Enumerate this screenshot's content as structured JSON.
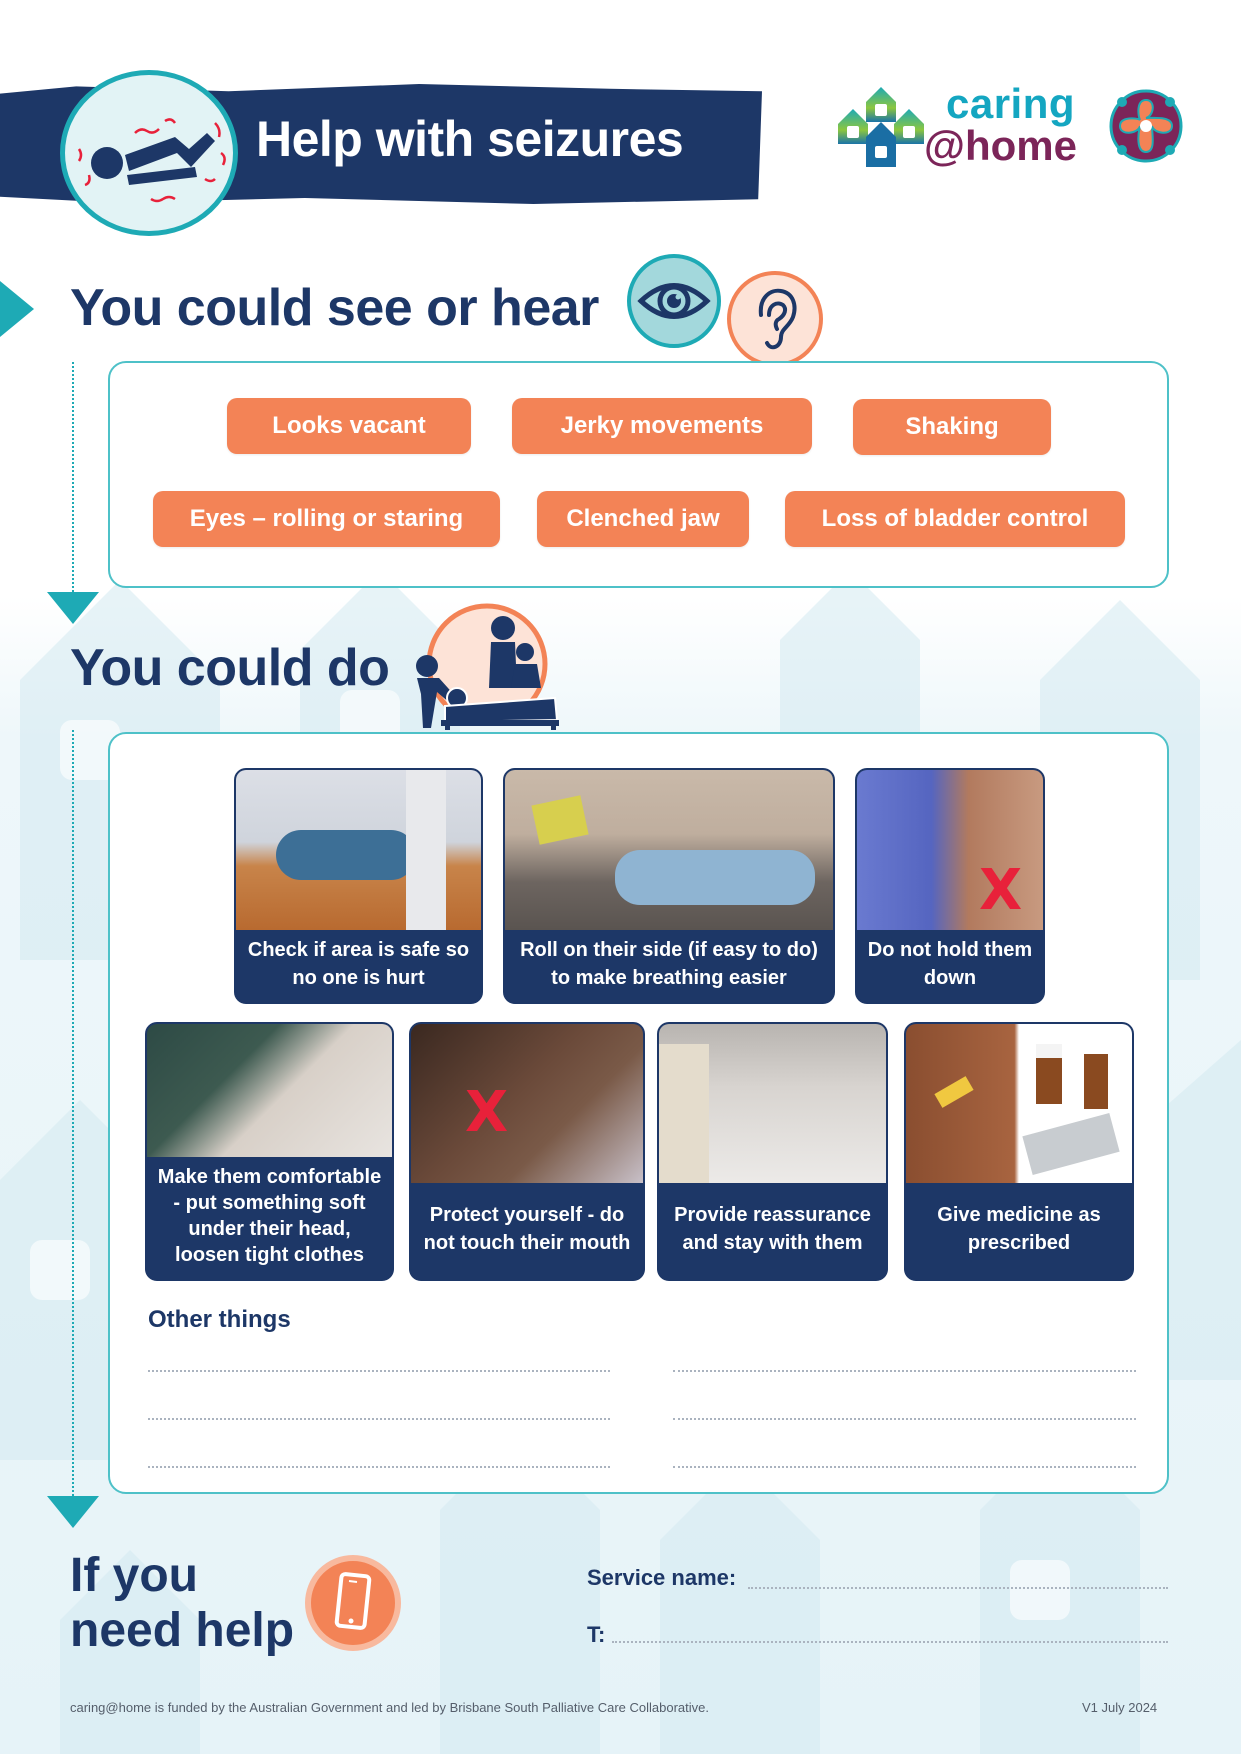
{
  "header": {
    "title": "Help with seizures",
    "badge_icon": "seizure-person-icon",
    "logo": {
      "line1": "caring",
      "line2": "@home",
      "brand_colors": {
        "caring": "#14a6c1",
        "home": "#7c2559"
      },
      "house_icon": "houses-logo-icon",
      "emblem_icon": "aboriginal-art-emblem-icon"
    }
  },
  "colors": {
    "navy": "#1d3767",
    "teal": "#1eaab5",
    "orange": "#f38356",
    "red_x": "#e8213a"
  },
  "see_hear": {
    "heading": "You could see or hear",
    "icons": [
      "eye-icon",
      "ear-icon"
    ],
    "signs": [
      "Looks vacant",
      "Jerky movements",
      "Shaking",
      "Eyes – rolling or staring",
      "Clenched jaw",
      "Loss of bladder control"
    ]
  },
  "could_do": {
    "heading": "You could do",
    "icon": "caregivers-at-bedside-icon",
    "actions": [
      {
        "caption": "Check if area is safe so no one is hurt",
        "photo": "woman lying on floor",
        "not_allowed": false
      },
      {
        "caption": "Roll on their side (if easy to do) to make breathing easier",
        "photo": "woman rolling man onto side",
        "not_allowed": false
      },
      {
        "caption": "Do not hold them down",
        "photo": "person holding legs down",
        "not_allowed": true,
        "mark": "X"
      },
      {
        "caption": "Make them comfortable - put something soft under their head, loosen tight clothes",
        "photo": "elderly woman on pillow",
        "not_allowed": false
      },
      {
        "caption": "Protect yourself - do not touch their mouth",
        "photo": "hand near mouth",
        "not_allowed": true,
        "mark": "X"
      },
      {
        "caption": "Provide reassurance and stay with them",
        "photo": "woman sitting with man in bed",
        "not_allowed": false
      },
      {
        "caption": "Give medicine as prescribed",
        "photo": "subcutaneous line, bottles and tablets",
        "not_allowed": false
      }
    ],
    "other_title": "Other things"
  },
  "help": {
    "heading_line1": "If you",
    "heading_line2": "need help",
    "icon": "mobile-phone-icon",
    "service_label": "Service name:",
    "phone_label": "T:"
  },
  "footer": {
    "funding": "caring@home is funded by the Australian Government and led by Brisbane South Palliative Care Collaborative.",
    "version": "V1 July 2024"
  }
}
